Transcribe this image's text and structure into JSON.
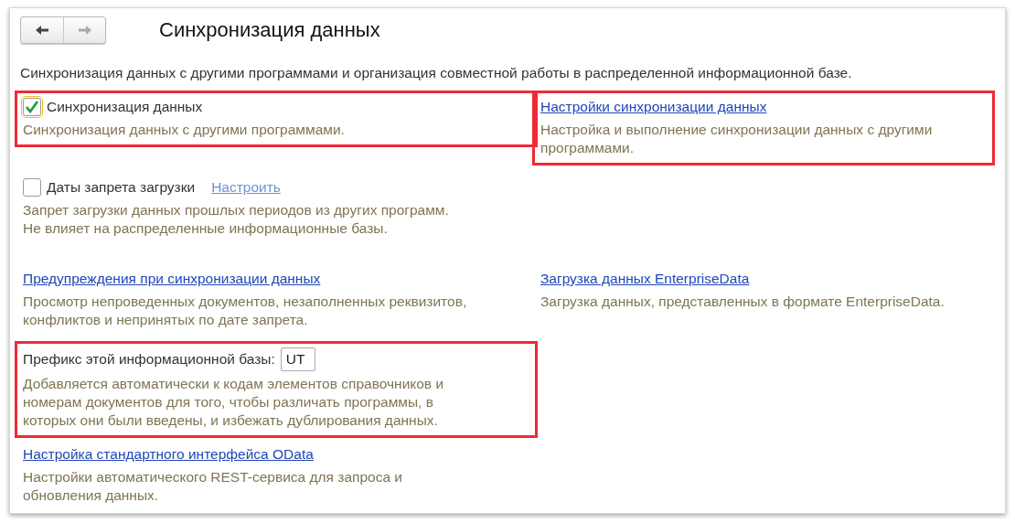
{
  "window": {
    "title": "Синхронизация данных"
  },
  "nav": [
    {
      "kind": "back",
      "disabled": false
    },
    {
      "kind": "forward",
      "disabled": true
    }
  ],
  "intro": "Синхронизация данных с другими программами и организация совместной работы в распределенной информационной базе.",
  "rows": [
    {
      "left": {
        "kind": "checkbox",
        "label": "Синхронизация данных",
        "checked": true,
        "highlighted": true,
        "description": "Синхронизация данных с другими программами."
      },
      "right": {
        "kind": "link",
        "label": "Настройки синхронизации данных",
        "highlighted": true,
        "description": "Настройка и выполнение синхронизации данных с другими программами."
      }
    },
    {
      "left": {
        "kind": "checkbox",
        "label": "Даты запрета загрузки",
        "checked": false,
        "link": "Настроить",
        "description": "Запрет загрузки данных прошлых периодов из других программ.\nНе влияет на распределенные информационные базы."
      }
    },
    {
      "left": {
        "kind": "link",
        "label": "Предупреждения при синхронизации данных",
        "description": "Просмотр непроведенных документов, незаполненных реквизитов,\nконфликтов и непринятых по дате запрета."
      },
      "right": {
        "kind": "link",
        "label": "Загрузка данных EnterpriseData",
        "description": "Загрузка данных, представленных в формате EnterpriseData."
      }
    },
    {
      "left": {
        "kind": "field",
        "label": "Префикс этой информационной базы:",
        "value": "UT",
        "highlighted": true,
        "description": "Добавляется автоматически к кодам элементов справочников и\nномерам документов для того, чтобы различать программы, в\nкоторых они были введены, и избежать дублирования данных."
      }
    },
    {
      "left": {
        "kind": "link",
        "label": "Настройка стандартного интерфейса OData",
        "description": "Настройки автоматического REST-сервиса для запроса и\nобновления данных."
      }
    }
  ]
}
